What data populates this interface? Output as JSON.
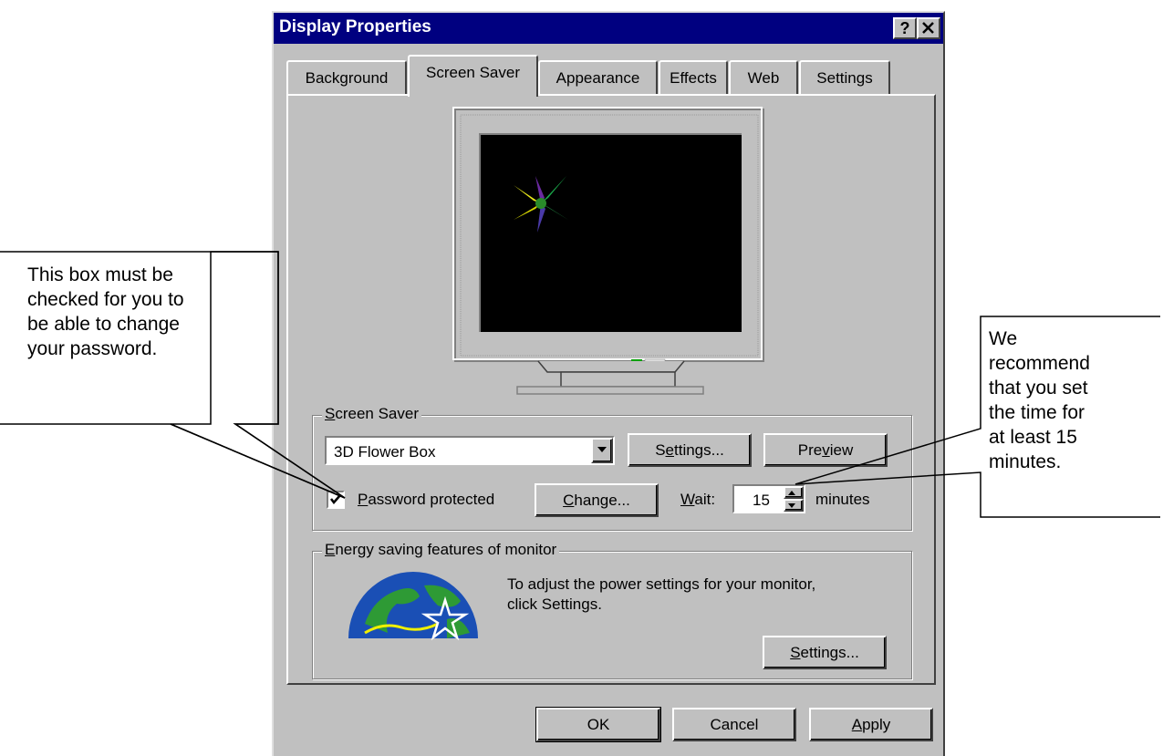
{
  "window": {
    "title": "Display Properties",
    "help_glyph": "?",
    "close_glyph": "✕"
  },
  "tabs": [
    {
      "label": "Background"
    },
    {
      "label": "Screen Saver",
      "active": true
    },
    {
      "label": "Appearance"
    },
    {
      "label": "Effects"
    },
    {
      "label": "Web"
    },
    {
      "label": "Settings"
    }
  ],
  "screen_saver": {
    "group_label_key": "S",
    "group_label_rest": "creen Saver",
    "selected": "3D Flower Box",
    "settings_pre": "S",
    "settings_key": "e",
    "settings_post": "ttings...",
    "preview_pre": "Pre",
    "preview_key": "v",
    "preview_post": "iew",
    "password_checked": true,
    "password_key": "P",
    "password_rest": "assword protected",
    "change_key": "C",
    "change_rest": "hange...",
    "wait_key": "W",
    "wait_rest": "ait:",
    "wait_value": "15",
    "minutes_label": "minutes"
  },
  "energy": {
    "group_label_key": "E",
    "group_label_rest": "nergy saving features of monitor",
    "description_line1": "To adjust the power settings for your monitor,",
    "description_line2": "click Settings.",
    "settings_key": "S",
    "settings_rest": "ettings...",
    "logo_icon": "energy-star-logo"
  },
  "footer": {
    "ok_label": "OK",
    "cancel_label": "Cancel",
    "apply_key": "A",
    "apply_rest": "pply"
  },
  "callouts": {
    "left_lines": [
      "This box must be",
      "checked for you to",
      "be able to change",
      "your password."
    ],
    "right_lines": [
      "We",
      "recommend",
      "that you set",
      "the time for",
      "at least 15",
      "minutes."
    ]
  },
  "colors": {
    "titlebar": "#000080",
    "dialog_face": "#c0c0c0",
    "preview_screen": "#000000"
  }
}
